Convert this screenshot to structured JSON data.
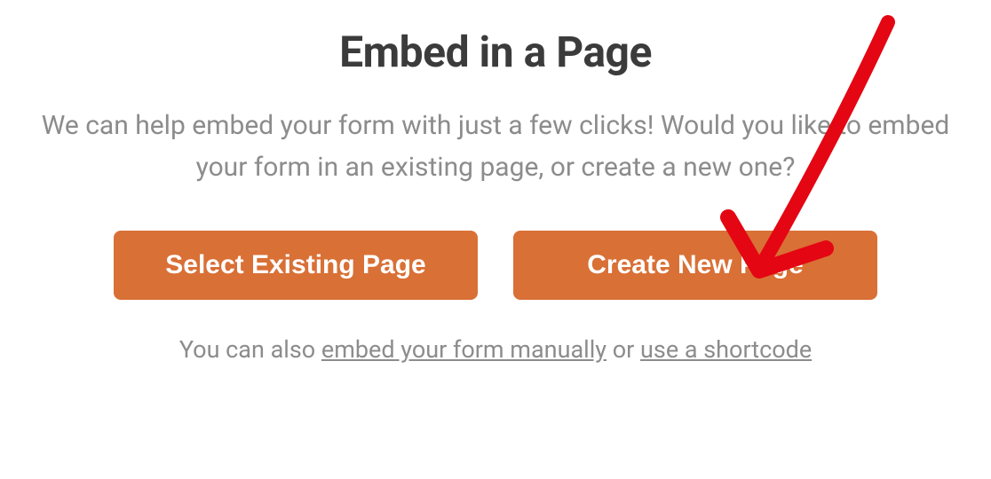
{
  "modal": {
    "title": "Embed in a Page",
    "description": "We can help embed your form with just a few clicks! Would you like to embed your form in an existing page, or create a new one?",
    "buttons": {
      "select_existing": "Select Existing Page",
      "create_new": "Create New Page"
    },
    "footer": {
      "prefix": "You can also ",
      "link_manual": "embed your form manually",
      "separator": " or ",
      "link_shortcode": "use a shortcode"
    }
  },
  "colors": {
    "accent": "#d97036",
    "heading": "#3b3b3b",
    "body_text": "#8c8c8c",
    "annotation": "#e40613"
  }
}
